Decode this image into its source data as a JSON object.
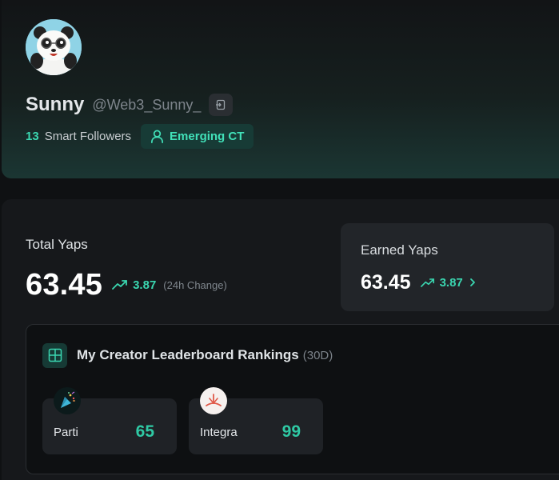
{
  "profile": {
    "display_name": "Sunny",
    "handle": "@Web3_Sunny_",
    "smart_followers_count": "13",
    "smart_followers_label": "Smart Followers",
    "tier_badge": "Emerging CT"
  },
  "stats": {
    "total_label": "Total Yaps",
    "total_value": "63.45",
    "total_change": "3.87",
    "change_caption": "(24h Change)",
    "earned_label": "Earned Yaps",
    "earned_value": "63.45",
    "earned_change": "3.87"
  },
  "leaderboard": {
    "title": "My Creator Leaderboard Rankings",
    "period": "(30D)",
    "items": [
      {
        "name": "Parti",
        "rank": "65",
        "logo": "party-popper-icon"
      },
      {
        "name": "Integra",
        "rank": "99",
        "logo": "integra-logo-icon"
      }
    ]
  },
  "colors": {
    "accent": "#3ad6b0",
    "background": "#0f1113",
    "panel": "#16181b",
    "card": "#222529",
    "badge_bg": "#173b36"
  }
}
